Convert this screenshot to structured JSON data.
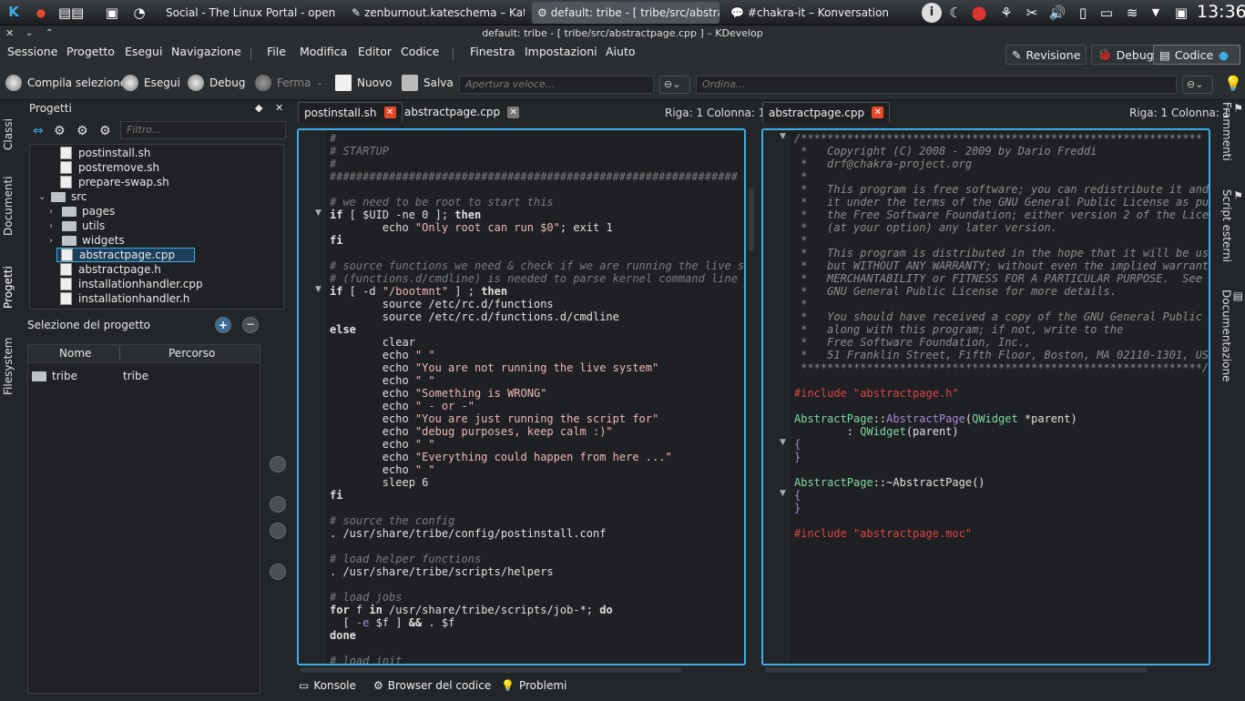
{
  "taskbar": {
    "tasks": [
      {
        "label": "Social - The Linux Portal - openD"
      },
      {
        "label": "zenburnout.kateschema – Kate"
      },
      {
        "label": "default: tribe - [ tribe/src/abstra"
      },
      {
        "label": "#chakra-it – Konversation"
      }
    ],
    "clock": "13:36"
  },
  "window": {
    "title": "default:  tribe - [ tribe/src/abstractpage.cpp ] – KDevelop"
  },
  "menu": {
    "items": [
      "Sessione",
      "Progetto",
      "Esegui",
      "Navigazione",
      "File",
      "Modifica",
      "Editor",
      "Codice",
      "Finestra",
      "Impostazioni",
      "Aiuto"
    ]
  },
  "areas": {
    "revisione": "Revisione",
    "debug": "Debug",
    "codice": "Codice"
  },
  "toolbar": {
    "compila": "Compila selezione",
    "esegui": "Esegui",
    "debug": "Debug",
    "ferma": "Ferma",
    "nuovo": "Nuovo",
    "salva": "Salva",
    "apertura_placeholder": "Apertura veloce...",
    "ordina_placeholder": "Ordina..."
  },
  "left_tabs": {
    "classi": "Classi",
    "documenti": "Documenti",
    "progetti": "Progetti",
    "filesystem": "Filesystem"
  },
  "right_tabs": {
    "frammenti": "Frammenti",
    "script": "Script esterni",
    "doc": "Documentazione"
  },
  "projects": {
    "title": "Progetti",
    "filter_placeholder": "Filtro...",
    "tree": [
      {
        "label": "postinstall.sh",
        "type": "file"
      },
      {
        "label": "postremove.sh",
        "type": "file"
      },
      {
        "label": "prepare-swap.sh",
        "type": "file"
      },
      {
        "label": "src",
        "type": "folder"
      },
      {
        "label": "pages",
        "type": "folder"
      },
      {
        "label": "utils",
        "type": "folder"
      },
      {
        "label": "widgets",
        "type": "folder"
      },
      {
        "label": "abstractpage.cpp",
        "type": "file"
      },
      {
        "label": "abstractpage.h",
        "type": "file"
      },
      {
        "label": "installationhandler.cpp",
        "type": "file"
      },
      {
        "label": "installationhandler.h",
        "type": "file"
      }
    ],
    "selection_title": "Selezione del progetto",
    "col_name": "Nome",
    "col_path": "Percorso",
    "row_name": "tribe",
    "row_path": "tribe"
  },
  "editor_left": {
    "tab1": "postinstall.sh",
    "tab2": "abstractpage.cpp",
    "cursor": "Riga: 1 Colonna: 1"
  },
  "editor_right": {
    "tab1": "abstractpage.cpp",
    "cursor": "Riga: 1 Colonna: 1"
  },
  "bottom": {
    "konsole": "Konsole",
    "browser": "Browser del codice",
    "problemi": "Problemi"
  }
}
